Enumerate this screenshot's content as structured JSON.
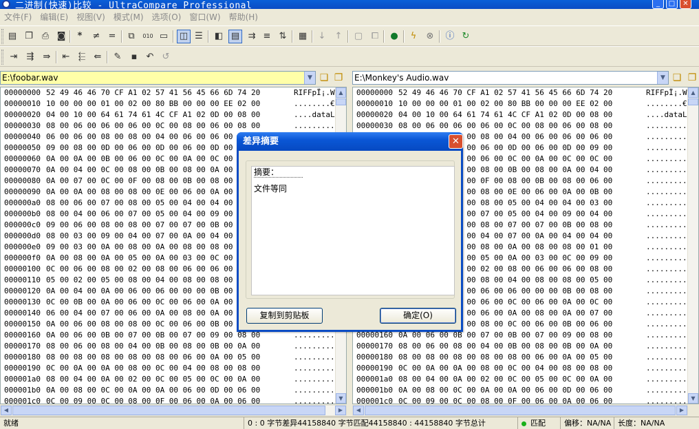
{
  "window": {
    "title": "二进制(快速)比较 - UltraCompare Professional",
    "min_glyph": "_",
    "max_glyph": "□",
    "close_glyph": "✕"
  },
  "menu": [
    "文件(F)",
    "编辑(E)",
    "视图(V)",
    "模式(M)",
    "选项(O)",
    "窗口(W)",
    "帮助(H)"
  ],
  "toolbar1": [
    "save-icon",
    "open-folder-icon",
    "print-icon",
    "print-preview-icon",
    "asterisk-icon",
    "not-equal-icon",
    "equal-icon",
    "copy-icon",
    "binary-icon",
    "folder-icon",
    "split-vertical-icon",
    "split-horizontal-icon",
    "merge-icon",
    "list-icon",
    "export-icon",
    "lines-icon",
    "swap-icon",
    "grid-icon",
    "arrow-down-icon",
    "arrow-up-icon",
    "window-icon",
    "windows-icon",
    "globe-icon",
    "lightning-icon",
    "stop-icon",
    "info-icon",
    "refresh-icon"
  ],
  "toolbar2": [
    "merge-right-icon",
    "merge-right-all-icon",
    "merge-right-block-icon",
    "merge-left-icon",
    "merge-left-all-icon",
    "merge-left-block-icon",
    "edit-icon",
    "save-icon",
    "undo-alt-icon",
    "undo-icon"
  ],
  "left_path": "E:\\foobar.wav",
  "right_path": "E:\\Monkey's Audio.wav",
  "hex_rows": [
    {
      "addr": "00000000",
      "bytes": "52 49 46 46 70 CF A1 02 57 41 56 45 66 6D 74 20",
      "ascii": "RIFFpÏ¡.WAVEfmt "
    },
    {
      "addr": "00000010",
      "bytes": "10 00 00 00 01 00 02 00 80 BB 00 00 00 EE 02 00",
      "ascii": "........€»...î.."
    },
    {
      "addr": "00000020",
      "bytes": "04 00 10 00 64 61 74 61 4C CF A1 02 0D 00 08 00",
      "ascii": "....dataLÏ¡....."
    },
    {
      "addr": "00000030",
      "bytes": "08 00 06 00 06 00 06 00 0C 00 08 00 06 00 08 00",
      "ascii": "................"
    },
    {
      "addr": "00000040",
      "bytes": "06 00 06 00 08 00 08 00 04 00 06 00 06 00 06 00",
      "ascii": "................"
    },
    {
      "addr": "00000050",
      "bytes": "09 00 08 00 0D 00 06 00 0D 00 06 00 0D 00 09 00",
      "ascii": "................"
    },
    {
      "addr": "00000060",
      "bytes": "0A 00 0A 00 0B 00 06 00 0C 00 0A 00 0C 00 0C 00",
      "ascii": "................"
    },
    {
      "addr": "00000070",
      "bytes": "0A 00 04 00 0C 00 08 00 0B 00 08 00 0A 00 04 00",
      "ascii": "................"
    },
    {
      "addr": "00000080",
      "bytes": "0A 00 07 00 0C 00 0F 00 08 00 0B 00 08 00 06 00",
      "ascii": "................"
    },
    {
      "addr": "00000090",
      "bytes": "0A 00 0A 00 08 00 08 00 0E 00 06 00 0A 00 0B 00",
      "ascii": "................"
    },
    {
      "addr": "000000a0",
      "bytes": "08 00 06 00 07 00 08 00 05 00 04 00 04 00 03 00",
      "ascii": "................"
    },
    {
      "addr": "000000b0",
      "bytes": "08 00 04 00 06 00 07 00 05 00 04 00 09 00 04 00",
      "ascii": "................"
    },
    {
      "addr": "000000c0",
      "bytes": "09 00 06 00 08 00 08 00 07 00 07 00 0B 00 08 00",
      "ascii": "................"
    },
    {
      "addr": "000000d0",
      "bytes": "08 00 03 00 09 00 04 00 07 00 0A 00 04 00 04 00",
      "ascii": "................"
    },
    {
      "addr": "000000e0",
      "bytes": "09 00 03 00 0A 00 08 00 0A 00 08 00 08 00 01 00",
      "ascii": "................"
    },
    {
      "addr": "000000f0",
      "bytes": "0A 00 08 00 0A 00 05 00 0A 00 03 00 0C 00 09 00",
      "ascii": "................"
    },
    {
      "addr": "00000100",
      "bytes": "0C 00 06 00 08 00 02 00 08 00 06 00 06 00 08 00",
      "ascii": "................"
    },
    {
      "addr": "00000110",
      "bytes": "05 00 02 00 05 00 08 00 04 00 08 00 08 00 05 00",
      "ascii": "................"
    },
    {
      "addr": "00000120",
      "bytes": "0A 00 04 00 0A 00 06 00 06 00 00 00 0B 00 08 00",
      "ascii": "................"
    },
    {
      "addr": "00000130",
      "bytes": "0C 00 0B 00 0A 00 06 00 0C 00 06 00 0A 00 0C 00",
      "ascii": "................"
    },
    {
      "addr": "00000140",
      "bytes": "06 00 04 00 07 00 06 00 0A 00 08 00 0A 00 07 00",
      "ascii": "................"
    },
    {
      "addr": "00000150",
      "bytes": "0A 00 06 00 08 00 08 00 0C 00 06 00 0B 00 06 00",
      "ascii": "................"
    },
    {
      "addr": "00000160",
      "bytes": "0A 00 06 00 0B 00 07 00 0B 00 07 00 09 00 08 00",
      "ascii": "................"
    },
    {
      "addr": "00000170",
      "bytes": "08 00 06 00 08 00 04 00 0B 00 08 00 0B 00 0A 00",
      "ascii": "................"
    },
    {
      "addr": "00000180",
      "bytes": "08 00 08 00 08 00 08 00 08 00 06 00 0A 00 05 00",
      "ascii": "................"
    },
    {
      "addr": "00000190",
      "bytes": "0C 00 0A 00 0A 00 08 00 0C 00 04 00 08 00 08 00",
      "ascii": "................"
    },
    {
      "addr": "000001a0",
      "bytes": "08 00 04 00 0A 00 02 00 0C 00 05 00 0C 00 0A 00",
      "ascii": "................"
    },
    {
      "addr": "000001b0",
      "bytes": "0A 00 08 00 0C 00 0A 00 0A 00 06 00 0D 00 06 00",
      "ascii": "................"
    },
    {
      "addr": "000001c0",
      "bytes": "0C 00 09 00 0C 00 08 00 0F 00 06 00 0A 00 06 00",
      "ascii": "................"
    }
  ],
  "status": {
    "ready": "就绪",
    "stats": "0 : 0 字节差异44158840 字节匹配44158840 : 44158840 字节总计",
    "match": "匹配",
    "offset": "偏移：NA/NA",
    "length": "长度：NA/NA"
  },
  "dialog": {
    "title": "差异摘要",
    "summary_label": "摘要：",
    "summary_text": "文件等同",
    "copy_button": "复制到剪贴板",
    "ok_button": "确定(O)"
  }
}
